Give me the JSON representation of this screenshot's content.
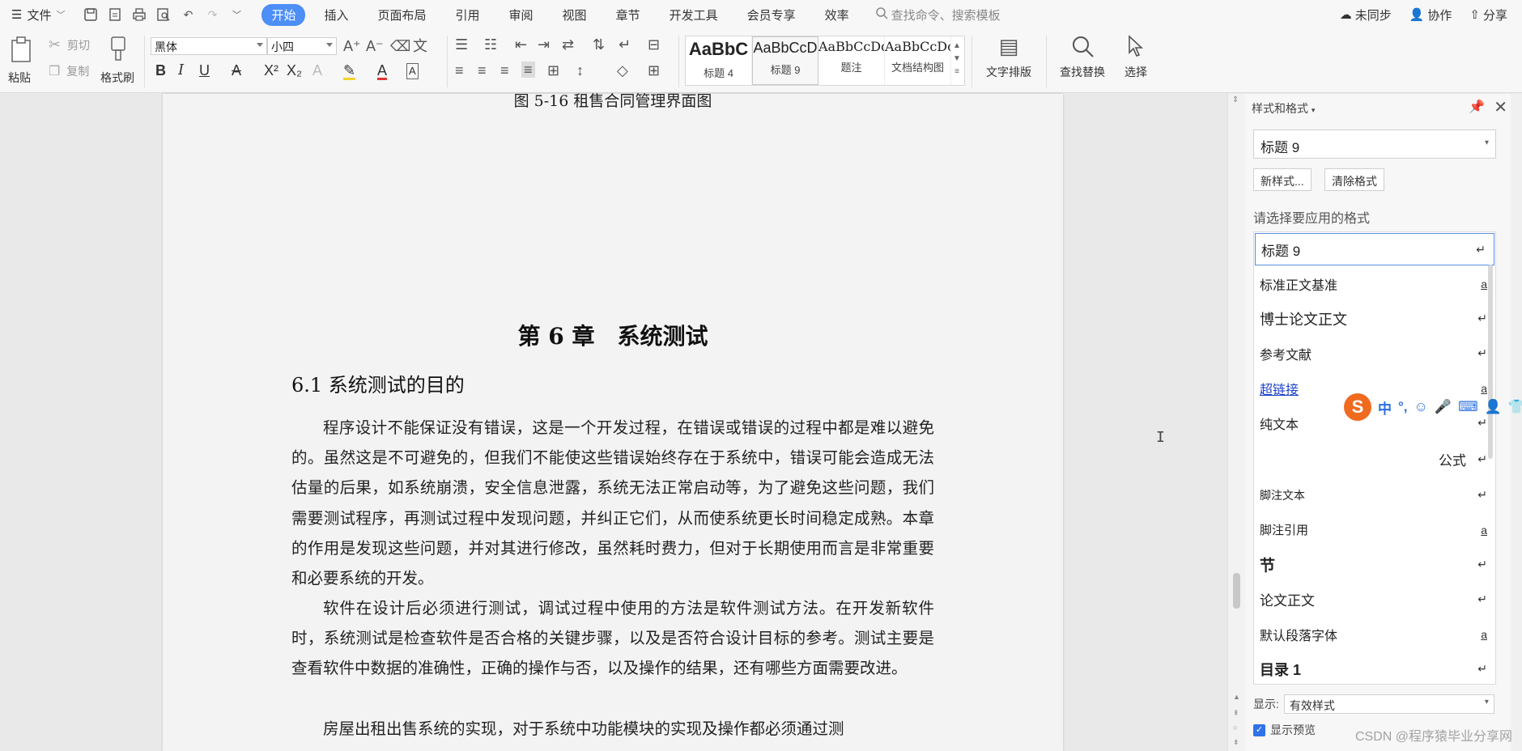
{
  "menubar": {
    "file_label": "文件",
    "tabs": [
      "开始",
      "插入",
      "页面布局",
      "引用",
      "审阅",
      "视图",
      "章节",
      "开发工具",
      "会员专享",
      "效率"
    ],
    "active_tab": "开始",
    "search_placeholder": "查找命令、搜索模板",
    "right": {
      "sync": "未同步",
      "collab": "协作",
      "share": "分享"
    }
  },
  "ribbon": {
    "paste": "粘贴",
    "cut": "剪切",
    "copy": "复制",
    "format_painter": "格式刷",
    "font_name": "黑体",
    "font_size": "小四",
    "styles": [
      {
        "preview": "AaBbC",
        "label": "标题 4"
      },
      {
        "preview": "AaBbCcD",
        "label": "标题 9"
      },
      {
        "preview": "AaBbCcDd",
        "label": "题注"
      },
      {
        "preview": "AaBbCcDc",
        "label": "文档结构图"
      }
    ],
    "text_layout": "文字排版",
    "find_replace": "查找替换",
    "select": "选择"
  },
  "document": {
    "fig_caption": "图 5-16 租售合同管理界面图",
    "chapter_title": "第 6 章　系统测试",
    "section_title": "6.1 系统测试的目的",
    "paragraphs": [
      "程序设计不能保证没有错误，这是一个开发过程，在错误或错误的过程中都是难以避免的。虽然这是不可避免的，但我们不能使这些错误始终存在于系统中，错误可能会造成无法估量的后果，如系统崩溃，安全信息泄露，系统无法正常启动等，为了避免这些问题，我们需要测试程序，再测试过程中发现问题，并纠正它们，从而使系统更长时间稳定成熟。本章的作用是发现这些问题，并对其进行修改，虽然耗时费力，但对于长期使用而言是非常重要和必要系统的开发。",
      "软件在设计后必须进行测试，调试过程中使用的方法是软件测试方法。在开发新软件时，系统测试是检查软件是否合格的关键步骤，以及是否符合设计目标的参考。测试主要是查看软件中数据的准确性，正确的操作与否，以及操作的结果，还有哪些方面需要改进。",
      "房屋出租出售系统的实现，对于系统中功能模块的实现及操作都必须通过测"
    ]
  },
  "style_pane": {
    "title": "样式和格式",
    "current_style": "标题 9",
    "new_style": "新样式...",
    "clear_format": "清除格式",
    "choose_label": "请选择要应用的格式",
    "styles": [
      {
        "name": "标题 9",
        "mark": "↵"
      },
      {
        "name": "标准正文基准",
        "mark": "a"
      },
      {
        "name": "博士论文正文",
        "mark": "↵"
      },
      {
        "name": "参考文献",
        "mark": "↵"
      },
      {
        "name": "超链接",
        "mark": "a"
      },
      {
        "name": "纯文本",
        "mark": "↵"
      },
      {
        "name": "公式",
        "mark": "↵"
      },
      {
        "name": "脚注文本",
        "mark": "↵"
      },
      {
        "name": "脚注引用",
        "mark": "a"
      },
      {
        "name": "节",
        "mark": "↵"
      },
      {
        "name": "论文正文",
        "mark": "↵"
      },
      {
        "name": "默认段落字体",
        "mark": "a"
      },
      {
        "name": "目录 1",
        "mark": "↵"
      }
    ],
    "show_label": "显示:",
    "show_value": "有效样式",
    "preview_label": "显示预览",
    "preview_checked": true
  },
  "ime": {
    "mode": "中",
    "punct": "°,"
  },
  "watermark": "CSDN @程序猿毕业分享网"
}
